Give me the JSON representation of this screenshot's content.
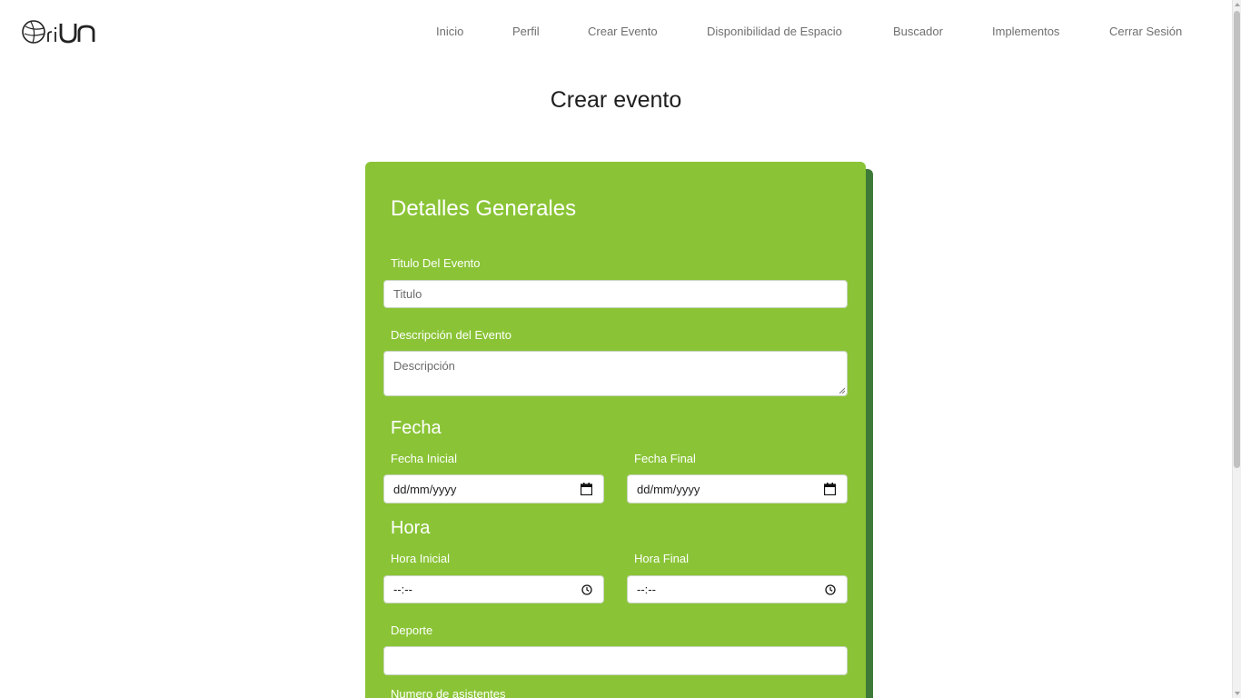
{
  "brand": {
    "logo_alt": "OriUN logo"
  },
  "nav": {
    "items": [
      {
        "label": "Inicio"
      },
      {
        "label": "Perfil"
      },
      {
        "label": "Crear Evento"
      },
      {
        "label": "Disponibilidad de Espacio"
      },
      {
        "label": "Buscador"
      },
      {
        "label": "Implementos"
      },
      {
        "label": "Cerrar Sesión"
      }
    ]
  },
  "page": {
    "title": "Crear evento"
  },
  "form": {
    "heading": "Detalles Generales",
    "title_label": "Titulo Del Evento",
    "title_placeholder": "Titulo",
    "description_label": "Descripción del Evento",
    "description_placeholder": "Descripción",
    "date_section": "Fecha",
    "start_date_label": "Fecha Inicial",
    "start_date_value": "dd/mm/yyyy",
    "end_date_label": "Fecha Final",
    "end_date_value": "dd/mm/yyyy",
    "time_section": "Hora",
    "start_time_label": "Hora Inicial",
    "start_time_value": "--:--",
    "end_time_label": "Hora Final",
    "end_time_value": "--:--",
    "sport_label": "Deporte",
    "sport_value": "",
    "attendees_label": "Numero de asistentes"
  },
  "colors": {
    "card": "#8ac436",
    "card_shadow": "#3d7a37",
    "nav_text": "#6f6f6f"
  },
  "icons": {
    "date": "calendar-icon",
    "time": "clock-icon"
  }
}
